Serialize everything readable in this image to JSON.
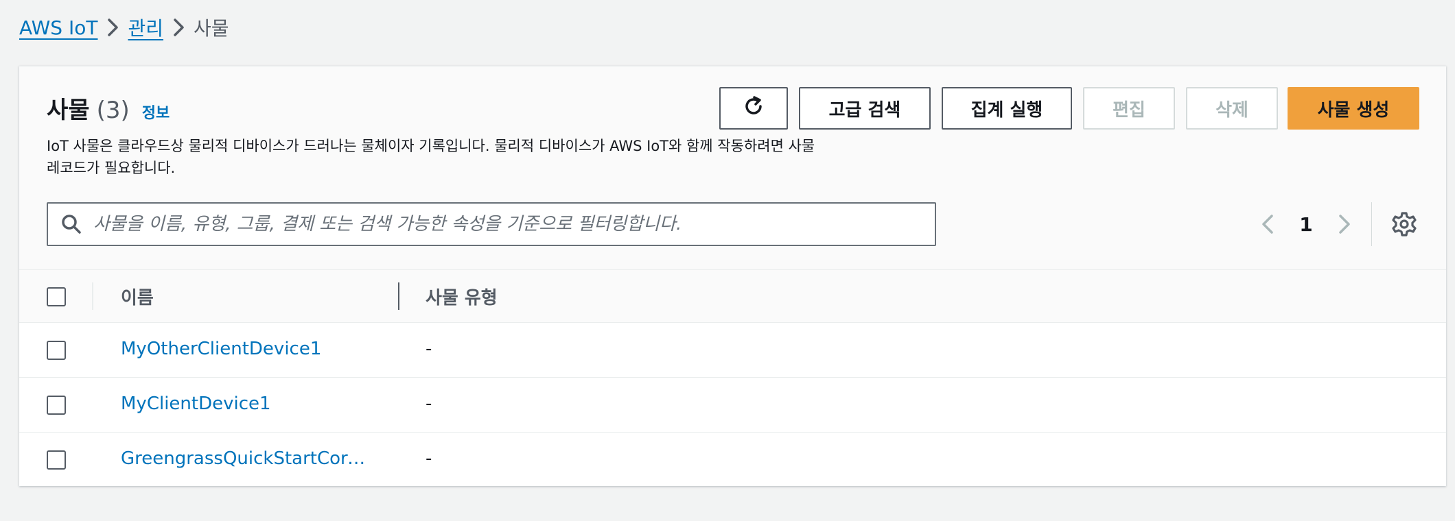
{
  "breadcrumb": {
    "items": [
      "AWS IoT",
      "관리",
      "사물"
    ]
  },
  "header": {
    "title": "사물",
    "count": "(3)",
    "info": "정보",
    "description": "IoT 사물은 클라우드상 물리적 디바이스가 드러나는 물체이자 기록입니다. 물리적 디바이스가 AWS IoT와 함께 작동하려면 사물 레코드가 필요합니다."
  },
  "toolbar": {
    "refresh_icon": "refresh-icon",
    "advanced_search": "고급 검색",
    "run_aggregation": "집계 실행",
    "edit": "편집",
    "delete": "삭제",
    "create": "사물 생성"
  },
  "search": {
    "placeholder": "사물을 이름, 유형, 그룹, 결제 또는 검색 가능한 속성을 기준으로 필터링합니다."
  },
  "pagination": {
    "current_page": "1"
  },
  "table": {
    "columns": [
      "이름",
      "사물 유형"
    ],
    "rows": [
      {
        "name": "MyOtherClientDevice1",
        "type": "-"
      },
      {
        "name": "MyClientDevice1",
        "type": "-"
      },
      {
        "name": "GreengrassQuickStartCore…",
        "type": "-"
      }
    ]
  },
  "colors": {
    "link": "#0073bb",
    "primary_button": "#f0a03c",
    "page_bg": "#f2f3f3"
  }
}
